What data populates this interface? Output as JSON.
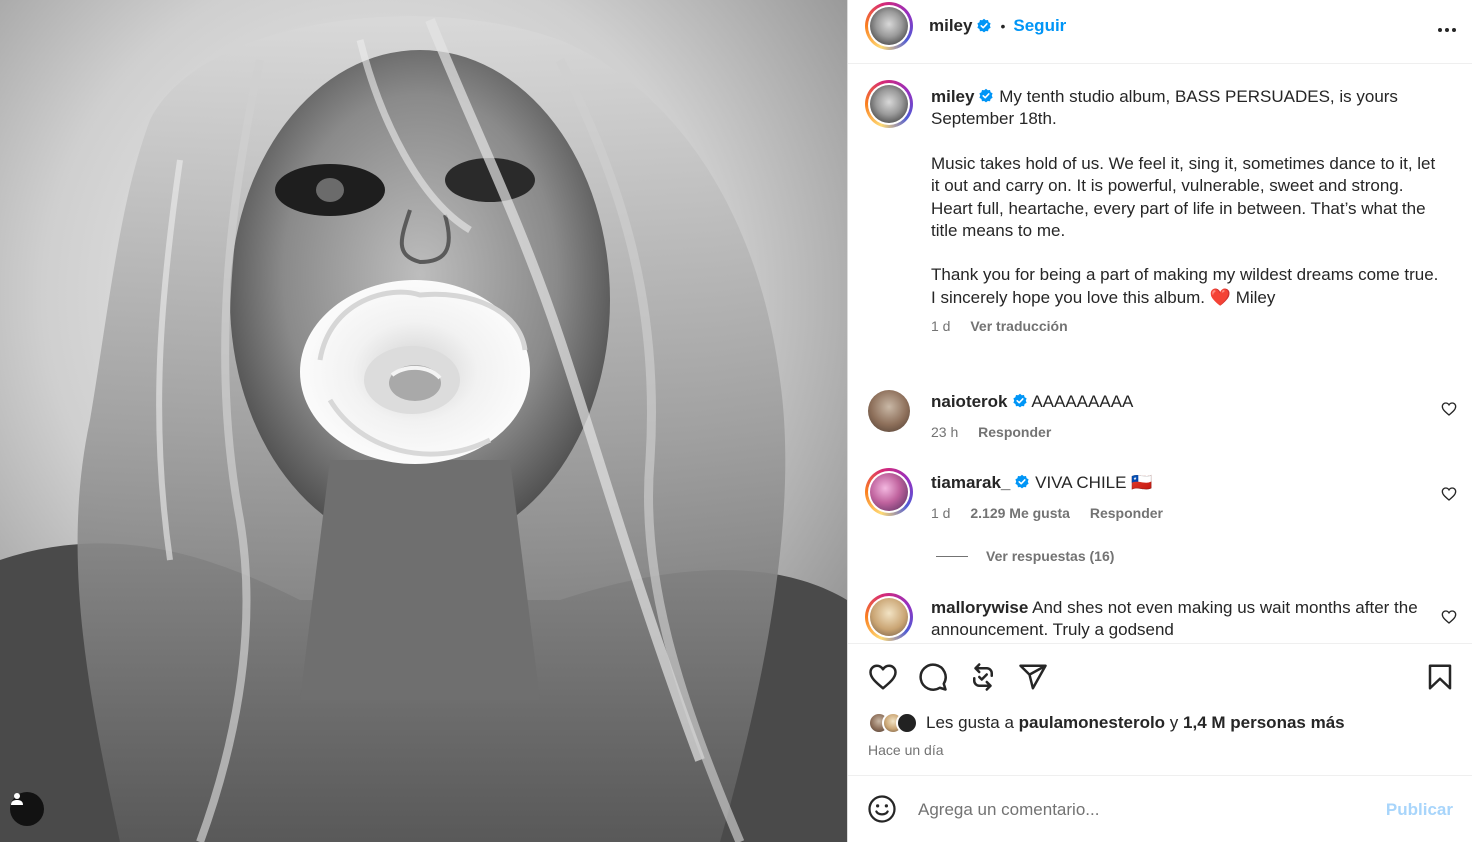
{
  "post": {
    "author": "miley",
    "follow_label": "Seguir",
    "separator": "•"
  },
  "caption": {
    "username": "miley",
    "lines": [
      "My tenth studio album, BASS PERSUADES, is yours September 18th.",
      "Music takes hold of us. We feel it, sing it, sometimes dance to it, let it out and carry on. It is powerful, vulnerable, sweet and strong.",
      "Heart full, heartache, every part of life in between. That’s what the title means to me.",
      "Thank you for being a part of making my wildest dreams come true. I sincerely hope you love this album."
    ],
    "emoji": "❤️",
    "signoff": "Miley",
    "time": "1 d",
    "translate_label": "Ver traducción"
  },
  "comments": [
    {
      "username": "naioterok",
      "text": "AAAAAAAAA",
      "time": "23 h",
      "reply_label": "Responder"
    },
    {
      "username": "tiamarak_",
      "text": "VIVA CHILE 🇨🇱",
      "time": "1 d",
      "likes": "2.129 Me gusta",
      "reply_label": "Responder",
      "view_replies_label": "Ver respuestas (16)"
    },
    {
      "username": "mallorywise",
      "text": "And shes not even making us wait months after the announcement. Truly a godsend"
    }
  ],
  "likes": {
    "prefix": "Les gusta a",
    "user": "paulamonesterolo",
    "conj": "y",
    "others": "1,4 M personas más"
  },
  "timestamp": "Hace un día",
  "composer": {
    "placeholder": "Agrega un comentario...",
    "submit_label": "Publicar"
  },
  "colors": {
    "link_blue": "#0095f6",
    "publish_disabled": "#a8d5fb",
    "verified_blue": "#0095f6",
    "heart_red": "#ff3040",
    "secondary_text": "#737373"
  },
  "icons": [
    "verified-icon",
    "more-options-icon",
    "heart-icon",
    "comment-icon",
    "repost-icon",
    "share-icon",
    "bookmark-icon",
    "emoji-icon",
    "user-tag-icon"
  ]
}
